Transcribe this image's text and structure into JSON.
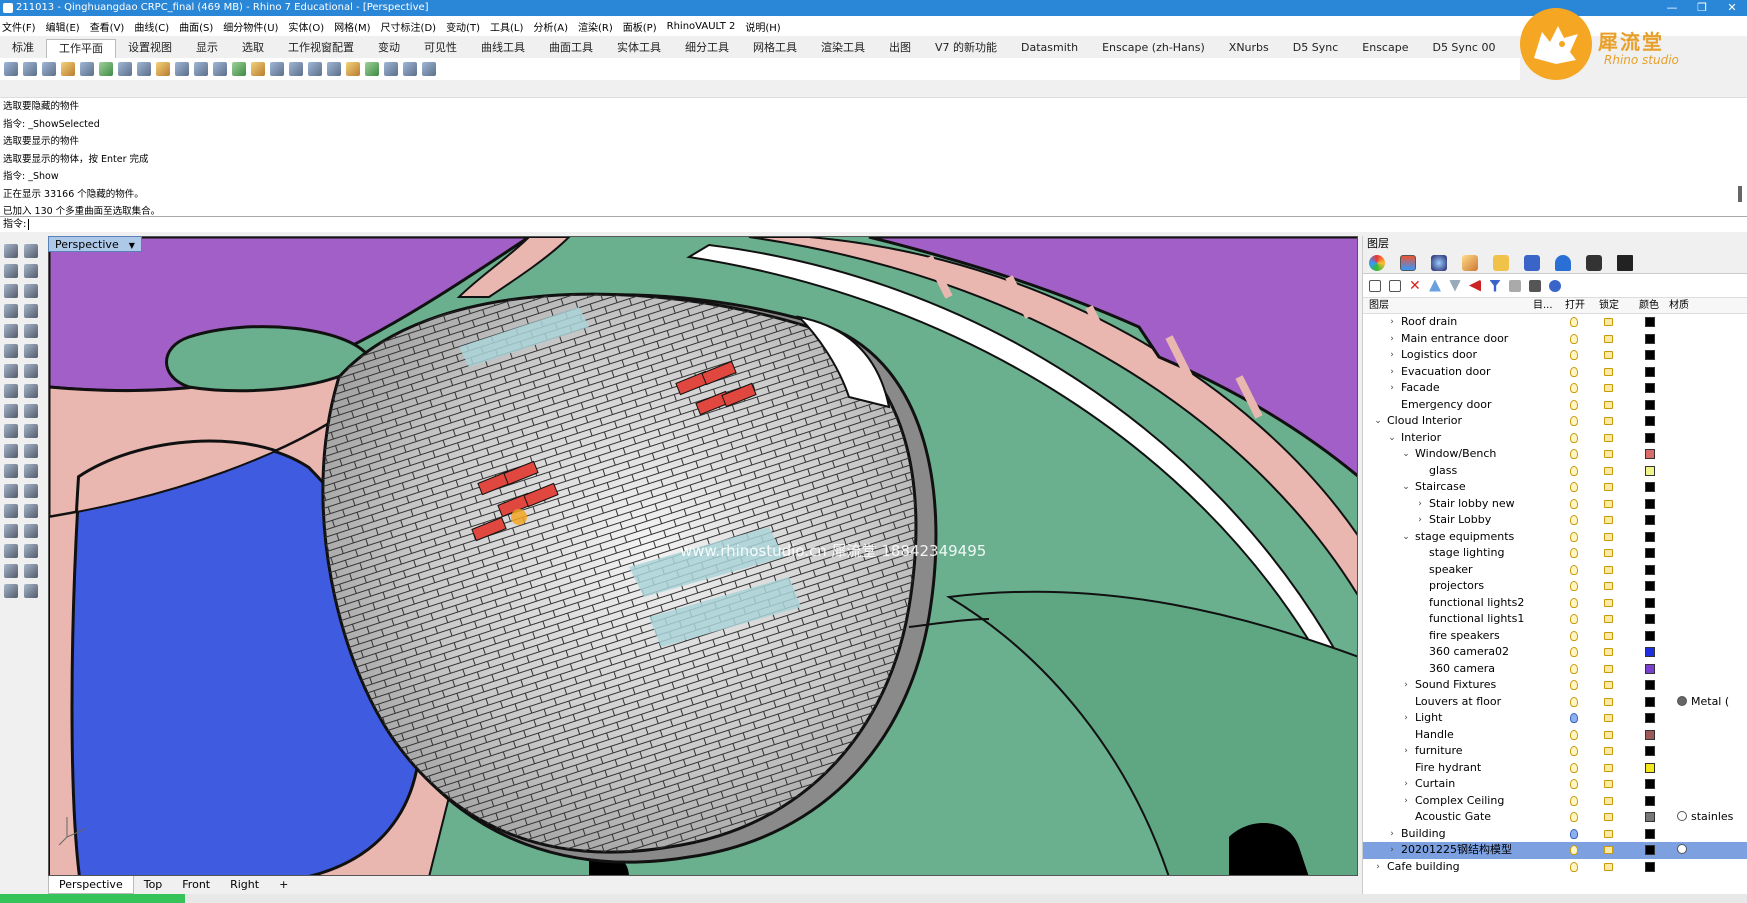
{
  "window": {
    "title": "211013 - Qinghuangdao CRPC_final (469 MB) - Rhino 7 Educational - [Perspective]",
    "controls": [
      "—",
      "❐",
      "✕"
    ]
  },
  "menu": [
    "文件(F)",
    "编辑(E)",
    "查看(V)",
    "曲线(C)",
    "曲面(S)",
    "细分物件(U)",
    "实体(O)",
    "网格(M)",
    "尺寸标注(D)",
    "变动(T)",
    "工具(L)",
    "分析(A)",
    "渲染(R)",
    "面板(P)",
    "RhinoVAULT 2",
    "说明(H)"
  ],
  "tabs": [
    "标准",
    "工作平面",
    "设置视图",
    "显示",
    "选取",
    "工作视窗配置",
    "变动",
    "可见性",
    "曲线工具",
    "曲面工具",
    "实体工具",
    "细分工具",
    "网格工具",
    "渲染工具",
    "出图",
    "V7 的新功能",
    "Datasmith",
    "Enscape (zh-Hans)",
    "XNurbs",
    "D5 Sync",
    "Enscape",
    "D5 Sync 00"
  ],
  "active_tab": "工作平面",
  "logo": {
    "cn": "犀流堂",
    "en": "Rhino studio"
  },
  "command_history": [
    "选取要隐藏的物件",
    "指令: _ShowSelected",
    "选取要显示的物件",
    "选取要显示的物体，按 Enter 完成",
    "指令: _Show",
    "正在显示 33166 个隐藏的物件。",
    "已加入 130 个多重曲面至选取集合。"
  ],
  "command_prompt": "指令:",
  "viewport": {
    "label": "Perspective",
    "watermark": "www.rhinostudio.cn 犀流堂 18842349495"
  },
  "view_tabs": [
    "Perspective",
    "Top",
    "Front",
    "Right"
  ],
  "layers_panel": {
    "title": "图层",
    "columns": {
      "layer": "图层",
      "current": "目...",
      "on": "打开",
      "lock": "锁定",
      "color": "颜色",
      "material": "材质"
    },
    "rows": [
      {
        "name": "Roof drain",
        "level": 1,
        "arrow": "›",
        "color": "#000000"
      },
      {
        "name": "Main entrance door",
        "level": 1,
        "arrow": "›",
        "color": "#000000"
      },
      {
        "name": "Logistics door",
        "level": 1,
        "arrow": "›",
        "color": "#000000"
      },
      {
        "name": "Evacuation door",
        "level": 1,
        "arrow": "›",
        "color": "#000000"
      },
      {
        "name": "Facade",
        "level": 1,
        "arrow": "›",
        "color": "#000000"
      },
      {
        "name": "Emergency door",
        "level": 1,
        "arrow": "",
        "color": "#000000"
      },
      {
        "name": "Cloud Interior",
        "level": 0,
        "arrow": "⌄",
        "color": "#000000"
      },
      {
        "name": "Interior",
        "level": 1,
        "arrow": "⌄",
        "color": "#000000"
      },
      {
        "name": "Window/Bench",
        "level": 2,
        "arrow": "⌄",
        "color": "#d96b6b"
      },
      {
        "name": "glass",
        "level": 3,
        "arrow": "",
        "color": "#f2f28a"
      },
      {
        "name": "Staircase",
        "level": 2,
        "arrow": "⌄",
        "color": "#000000"
      },
      {
        "name": "Stair lobby new",
        "level": 3,
        "arrow": "›",
        "color": "#000000"
      },
      {
        "name": "Stair Lobby",
        "level": 3,
        "arrow": "›",
        "color": "#000000"
      },
      {
        "name": "stage equipments",
        "level": 2,
        "arrow": "⌄",
        "color": "#000000"
      },
      {
        "name": "stage lighting",
        "level": 3,
        "arrow": "",
        "color": "#000000"
      },
      {
        "name": "speaker",
        "level": 3,
        "arrow": "",
        "color": "#000000"
      },
      {
        "name": "projectors",
        "level": 3,
        "arrow": "",
        "color": "#000000"
      },
      {
        "name": "functional lights2",
        "level": 3,
        "arrow": "",
        "color": "#000000"
      },
      {
        "name": "functional lights1",
        "level": 3,
        "arrow": "",
        "color": "#000000"
      },
      {
        "name": "fire speakers",
        "level": 3,
        "arrow": "",
        "color": "#000000"
      },
      {
        "name": "360 camera02",
        "level": 3,
        "arrow": "",
        "color": "#1f2ee0"
      },
      {
        "name": "360 camera",
        "level": 3,
        "arrow": "",
        "color": "#7a3fd1"
      },
      {
        "name": "Sound Fixtures",
        "level": 2,
        "arrow": "›",
        "color": "#000000"
      },
      {
        "name": "Louvers at floor",
        "level": 2,
        "arrow": "",
        "color": "#000000",
        "material": "Metal (",
        "matcolor": "#666666"
      },
      {
        "name": "Light",
        "level": 2,
        "arrow": "›",
        "color": "#000000",
        "bulb": "blue"
      },
      {
        "name": "Handle",
        "level": 2,
        "arrow": "",
        "color": "#9a5a5a"
      },
      {
        "name": "furniture",
        "level": 2,
        "arrow": "›",
        "color": "#000000"
      },
      {
        "name": "Fire hydrant",
        "level": 2,
        "arrow": "",
        "color": "#f5e81a"
      },
      {
        "name": "Curtain",
        "level": 2,
        "arrow": "›",
        "color": "#000000"
      },
      {
        "name": "Complex Ceiling",
        "level": 2,
        "arrow": "›",
        "color": "#000000"
      },
      {
        "name": "Acoustic Gate",
        "level": 2,
        "arrow": "",
        "color": "#777777",
        "material": "stainles",
        "matcolor": "#ffffff"
      },
      {
        "name": "Building",
        "level": 1,
        "arrow": "›",
        "color": "#000000",
        "bulb": "blue"
      },
      {
        "name": "20201225钢结构模型",
        "level": 1,
        "arrow": "›",
        "color": "#000000",
        "selected": true,
        "matcolor": "#ffffff",
        "material": ""
      },
      {
        "name": "Cafe building",
        "level": 0,
        "arrow": "›",
        "color": "#000000"
      }
    ]
  }
}
